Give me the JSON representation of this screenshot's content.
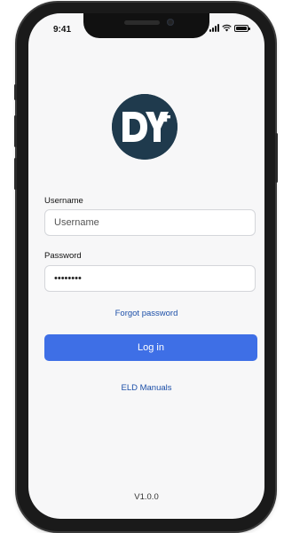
{
  "status_bar": {
    "time": "9:41",
    "icons": [
      "cellular-signal-icon",
      "wifi-icon",
      "battery-icon"
    ]
  },
  "logo": {
    "text": "DY+",
    "background_color": "#1f3a4d"
  },
  "login_form": {
    "username_label": "Username",
    "username_placeholder": "Username",
    "username_value": "",
    "password_label": "Password",
    "password_value": "••••••••",
    "forgot_password_label": "Forgot password",
    "login_button_label": "Log in",
    "eld_manuals_label": "ELD Manuals"
  },
  "footer": {
    "version": "V1.0.0"
  },
  "colors": {
    "accent": "#3e6fe6",
    "link": "#1c4fa8",
    "screen_background": "#f7f7f8"
  }
}
